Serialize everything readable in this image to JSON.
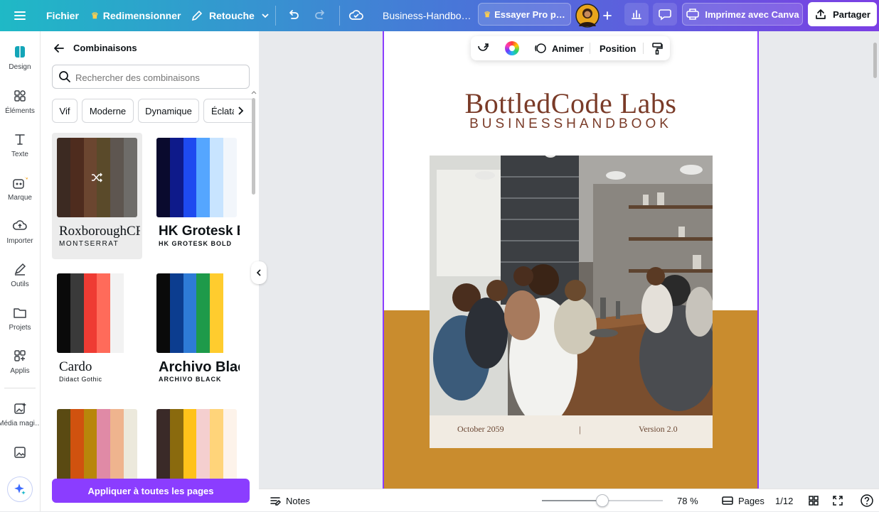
{
  "topbar": {
    "file_label": "Fichier",
    "resize_label": "Redimensionner",
    "edit_label": "Retouche",
    "doc_title": "Business-Handbo…",
    "try_pro_label": "Essayer Pro p…",
    "print_label": "Imprimez avec Canva",
    "share_label": "Partager"
  },
  "rail": {
    "items": [
      {
        "label": "Design"
      },
      {
        "label": "Éléments"
      },
      {
        "label": "Texte"
      },
      {
        "label": "Marque"
      },
      {
        "label": "Importer"
      },
      {
        "label": "Outils"
      },
      {
        "label": "Projets"
      },
      {
        "label": "Applis"
      },
      {
        "label": "Média magi…"
      }
    ]
  },
  "panel": {
    "title": "Combinaisons",
    "search_placeholder": "Rechercher des combinaisons",
    "filters": [
      "Vif",
      "Moderne",
      "Dynamique",
      "Éclata…"
    ],
    "palettes": [
      {
        "colors": [
          "#3c2a22",
          "#4e2c1e",
          "#6b4630",
          "#5a4a2a",
          "#5e5650",
          "#6e6c69"
        ],
        "font1": "RoxboroughCF",
        "font2": "MONTSERRAT"
      },
      {
        "colors": [
          "#0a0a2e",
          "#0e1a8a",
          "#1e4af0",
          "#55a6ff",
          "#c8e4ff",
          "#f2f6fb"
        ],
        "font1": "HK Grotesk Bold",
        "font2": "HK GROTESK BOLD"
      },
      {
        "colors": [
          "#0a0a0a",
          "#3a3a3a",
          "#ef3b33",
          "#ff6b5a",
          "#f2f2f2",
          "#ffffff"
        ],
        "font1": "Cardo",
        "font2": "Didact Gothic"
      },
      {
        "colors": [
          "#0a0a0a",
          "#0c3d8f",
          "#2e7bd6",
          "#1e9a4a",
          "#ffcc2e",
          "#ffffff"
        ],
        "font1": "Archivo Black",
        "font2": "ARCHIVO BLACK"
      },
      {
        "colors": [
          "#5a4a12",
          "#d0520f",
          "#b8860b",
          "#e08aa6",
          "#efb48e",
          "#ece9dc"
        ],
        "font1": "",
        "font2": ""
      },
      {
        "colors": [
          "#3a2a28",
          "#8a6a0e",
          "#ffc21a",
          "#f4cfcf",
          "#ffd47a",
          "#fdf3ea"
        ],
        "font1": "",
        "font2": ""
      }
    ],
    "apply_label": "Appliquer à toutes les pages"
  },
  "float_toolbar": {
    "animate_label": "Animer",
    "position_label": "Position"
  },
  "document": {
    "title": "BottledCode Labs",
    "subtitle": "BUSINESSHANDBOOK",
    "date": "October 2059",
    "divider": "|",
    "version": "Version 2.0",
    "accent_color": "#c98c2e"
  },
  "bottombar": {
    "notes_label": "Notes",
    "zoom": "78 %",
    "zoom_fraction": 0.5,
    "pages_label": "Pages",
    "page_count": "1/12"
  }
}
